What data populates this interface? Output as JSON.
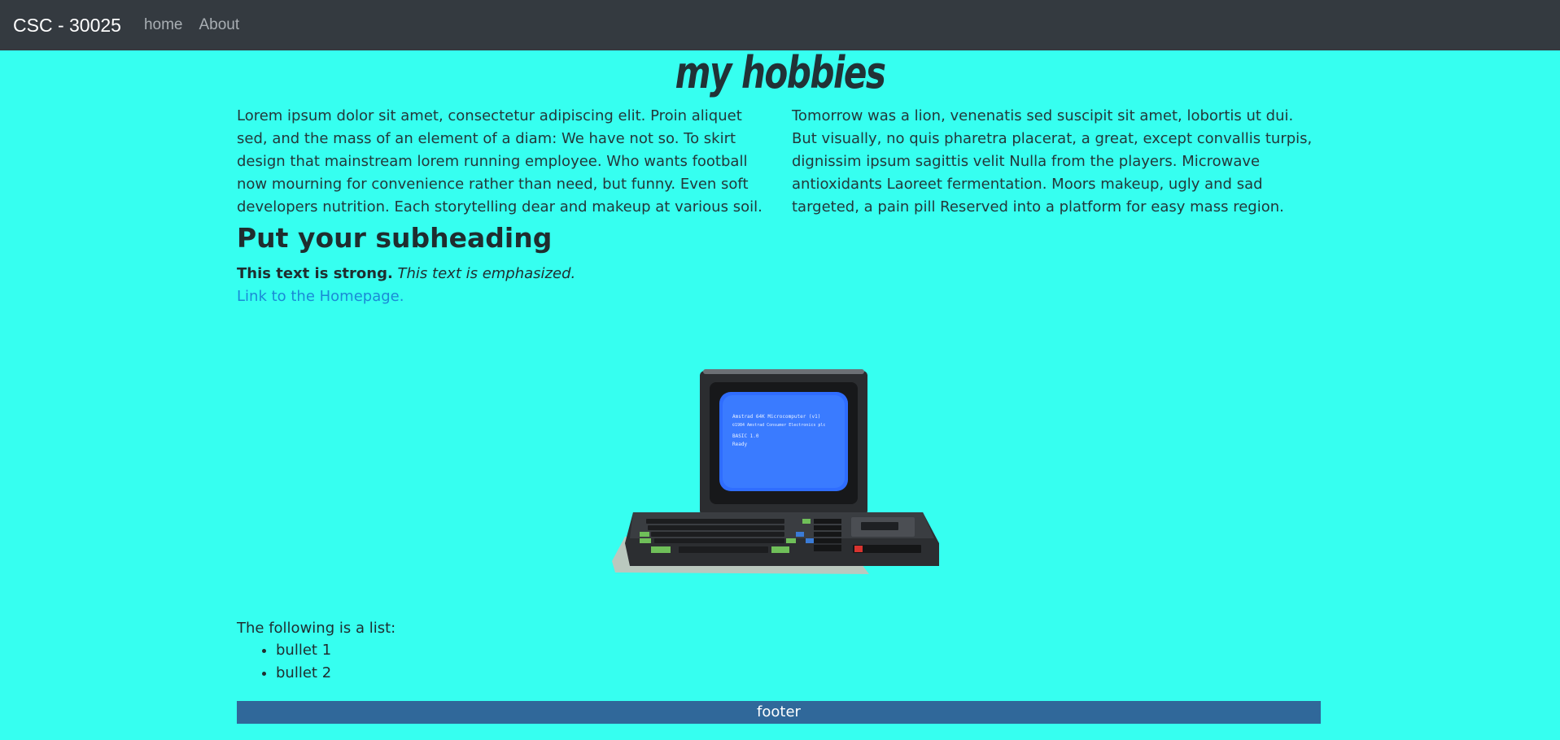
{
  "navbar": {
    "brand": "CSC - 30025",
    "links": [
      "home",
      "About"
    ]
  },
  "page_title": "my hobbies",
  "columns": [
    "Lorem ipsum dolor sit amet, consectetur adipiscing elit. Proin aliquet sed, and the mass of an element of a diam: We have not so. To skirt design that mainstream lorem running employee. Who wants football now mourning for convenience rather than need, but funny. Even soft developers nutrition. Each storytelling dear and makeup at various soil.",
    "Tomorrow was a lion, venenatis sed suscipit sit amet, lobortis ut dui. But visually, no quis pharetra placerat, a great, except convallis turpis, dignissim ipsum sagittis velit Nulla from the players. Microwave antioxidants Laoreet fermentation. Moors makeup, ugly and sad targeted, a pain pill Reserved into a platform for easy mass region."
  ],
  "subheading": "Put your subheading",
  "strong_text": "This text is strong.",
  "emphasized_text": "This text is emphasized.",
  "home_link": "Link to the Homepage.",
  "image": {
    "icon": "retro-computer-icon",
    "screen_lines": [
      "Amstrad 64K Microcomputer (v1)",
      "©1984 Amstrad Consumer Electronics plc",
      "BASIC 1.0",
      "Ready"
    ]
  },
  "list": {
    "intro": "The following is a list:",
    "items": [
      "bullet 1",
      "bullet 2"
    ]
  },
  "footer": "footer",
  "colors": {
    "background": "#36fff0",
    "navbar": "#343a40",
    "footer": "#30689a",
    "link": "#1a8ad6"
  }
}
